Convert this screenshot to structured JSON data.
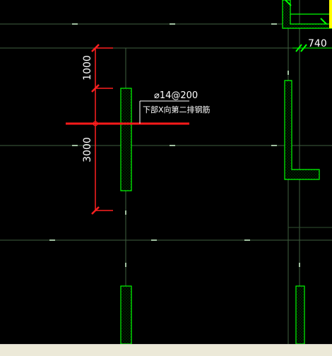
{
  "dimensions": {
    "top_span": "1000",
    "bottom_span": "3000",
    "right_width": "740"
  },
  "rebar": {
    "spec": "⌀14@200",
    "description": "下部X向第二排钢筋"
  },
  "colors": {
    "background": "#000000",
    "grid_line": "#3f5f3f",
    "wall": "#00ff00",
    "rebar_line": "#ff1a1a",
    "dimension": "#ff2020",
    "text": "#ffffff",
    "highlight": "#ffff00"
  }
}
